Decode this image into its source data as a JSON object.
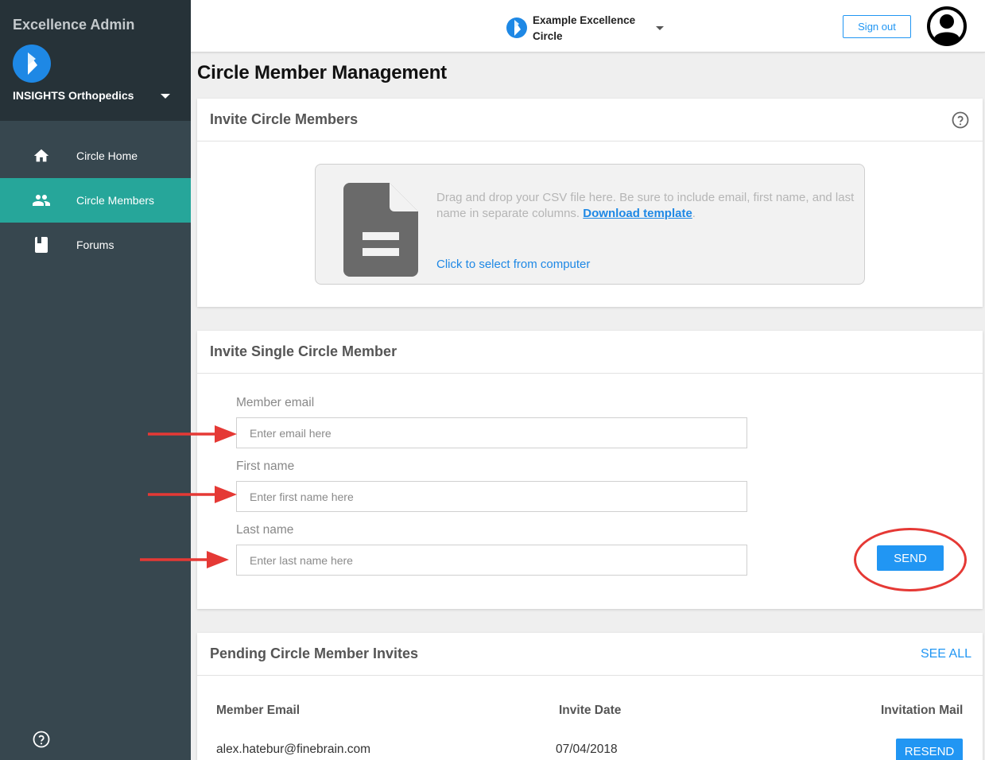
{
  "sidebar": {
    "app_title": "Excellence Admin",
    "org_name": "INSIGHTS Orthopedics",
    "items": [
      {
        "label": "Circle Home",
        "icon": "home-icon",
        "active": false
      },
      {
        "label": "Circle Members",
        "icon": "people-icon",
        "active": true
      },
      {
        "label": "Forums",
        "icon": "book-icon",
        "active": false
      }
    ]
  },
  "topbar": {
    "circle_name": "Example Excellence Circle",
    "signout_label": "Sign out"
  },
  "page": {
    "title": "Circle Member Management"
  },
  "invite_bulk": {
    "title": "Invite Circle Members",
    "drop_text": "Drag and drop your CSV file here. Be sure to include email, first name, and last name in separate columns.",
    "download_link": "Download template",
    "period": ".",
    "select_text": "Click to select from computer"
  },
  "invite_single": {
    "title": "Invite Single Circle Member",
    "email_label": "Member email",
    "email_placeholder": "Enter email here",
    "first_label": "First name",
    "first_placeholder": "Enter first name here",
    "last_label": "Last name",
    "last_placeholder": "Enter last name here",
    "send_label": "SEND"
  },
  "pending": {
    "title": "Pending Circle Member Invites",
    "see_all": "SEE ALL",
    "columns": [
      "Member Email",
      "Invite Date",
      "Invitation Mail"
    ],
    "rows": [
      {
        "email": "alex.hatebur@finebrain.com",
        "date": "07/04/2018",
        "action": "RESEND"
      }
    ]
  },
  "colors": {
    "sidebar_bg": "#37474f",
    "sidebar_top_bg": "#263238",
    "active_item": "#26a69a",
    "accent": "#2196f3",
    "annotation_red": "#e53935"
  }
}
